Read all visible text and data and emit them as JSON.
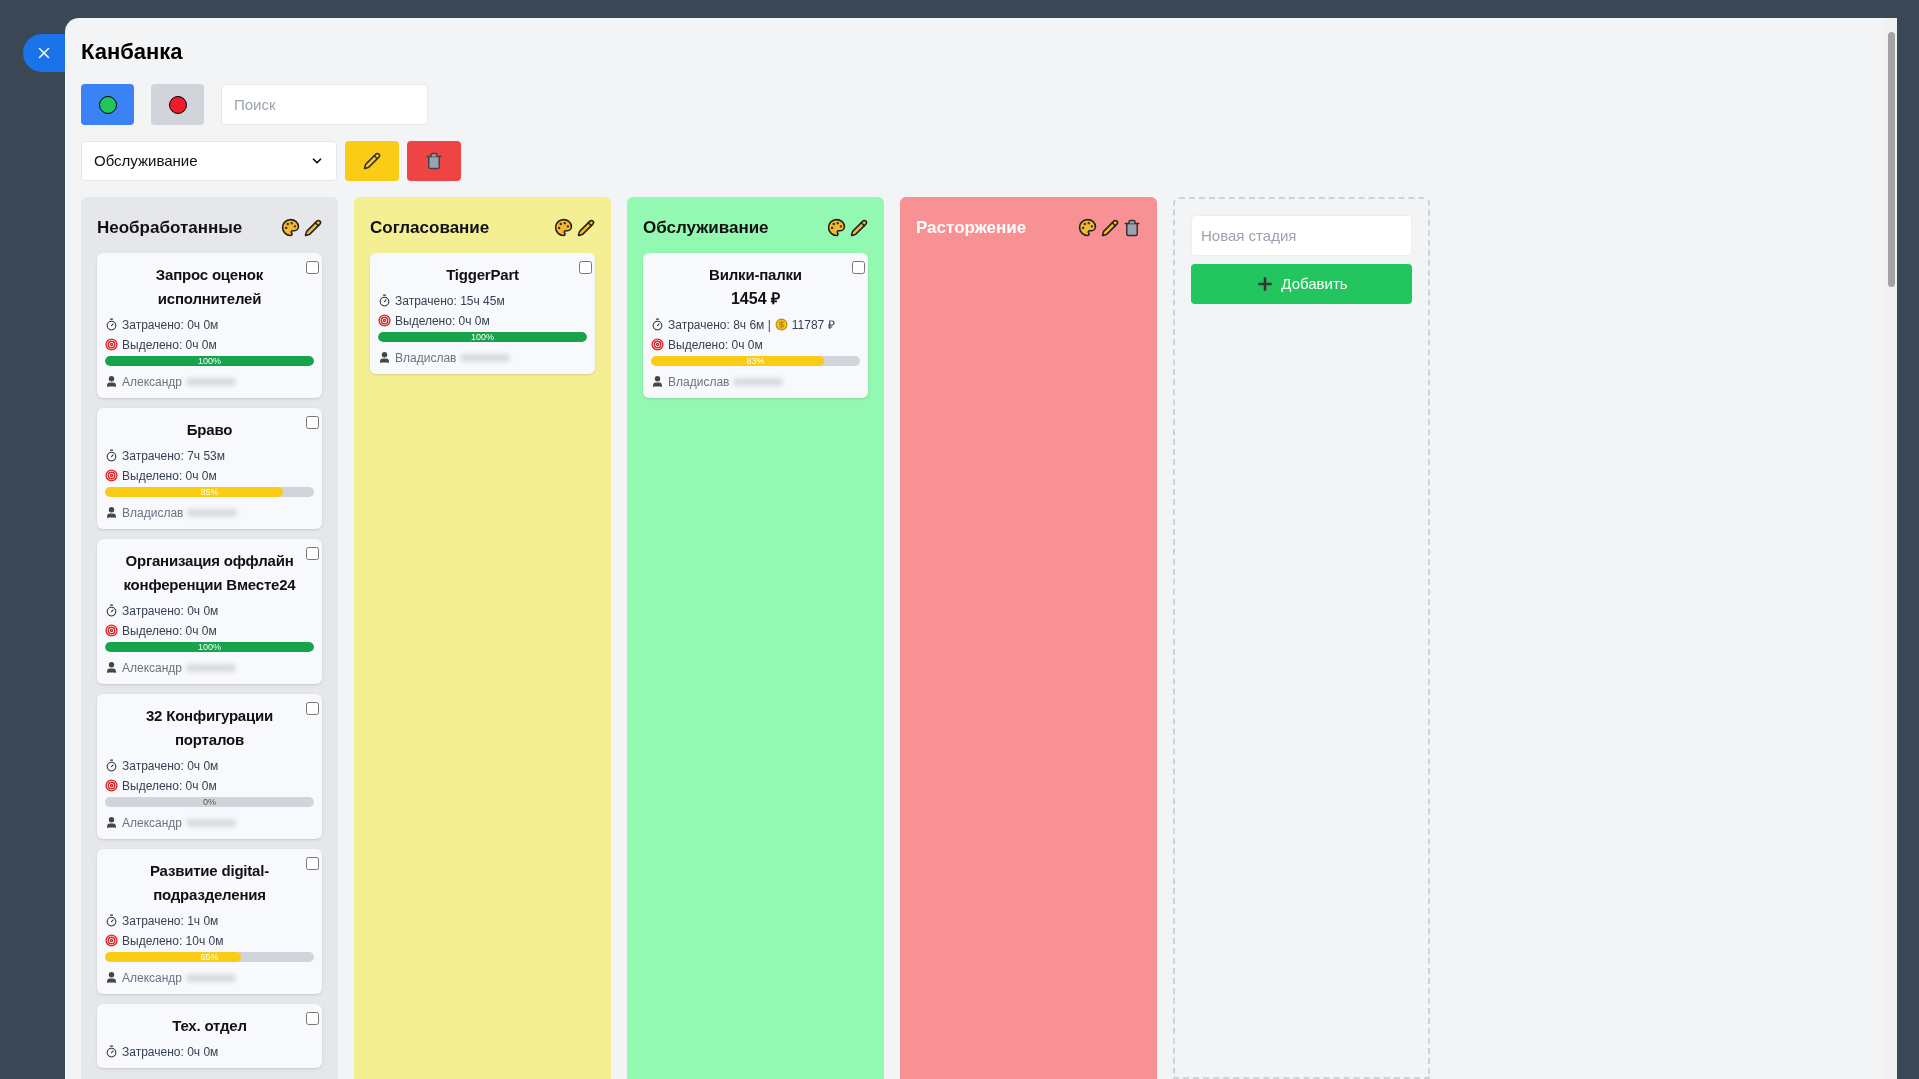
{
  "title": "Канбанка",
  "view_toggles": [
    {
      "kind": "green",
      "selected": true
    },
    {
      "kind": "red",
      "selected": false
    }
  ],
  "search": {
    "placeholder": "Поиск"
  },
  "stage_select": {
    "value": "Обслуживание"
  },
  "columns": [
    {
      "title": "Необработанные",
      "color": "#e5e7eb",
      "light_title": false,
      "deletable": false,
      "cards": [
        {
          "title": "Запрос оценок исполнителей",
          "checked": false,
          "spent": "Затрачено: 0ч 0м",
          "allocated": "Выделено: 0ч 0м",
          "level": 1,
          "progress": "100%",
          "user": "Александр"
        },
        {
          "title": "Браво",
          "checked": false,
          "spent": "Затрачено: 7ч 53м",
          "allocated": "Выделено: 0ч 0м",
          "level": 0.85,
          "progress": "85%",
          "user": "Владислав"
        },
        {
          "title": "Организация оффлайн конференции Вместе24",
          "checked": false,
          "spent": "Затрачено: 0ч 0м",
          "allocated": "Выделено: 0ч 0м",
          "level": 1,
          "progress": "100%",
          "user": "Александр"
        },
        {
          "title": "32 Конфигурации порталов",
          "checked": false,
          "spent": "Затрачено: 0ч 0м",
          "allocated": "Выделено: 0ч 0м",
          "level": 0,
          "progress": "0%",
          "user": "Александр"
        },
        {
          "title": "Развитие digital-подразделения",
          "checked": false,
          "spent": "Затрачено: 1ч 0м",
          "allocated": "Выделено: 10ч 0м",
          "level": 0.65,
          "progress": "65%",
          "user": "Александр"
        },
        {
          "title": "Тех. отдел",
          "checked": false,
          "spent": "Затрачено: 0ч 0м"
        }
      ]
    },
    {
      "title": "Согласование",
      "color": "#f5ef94",
      "light_title": false,
      "deletable": false,
      "cards": [
        {
          "title": "TiggerPart",
          "checked": false,
          "spent": "Затрачено: 15ч 45м",
          "allocated": "Выделено: 0ч 0м",
          "level": 1,
          "progress": "100%",
          "user": "Владислав"
        }
      ]
    },
    {
      "title": "Обслуживание",
      "color": "#93f8b1",
      "light_title": false,
      "deletable": false,
      "cards": [
        {
          "title": "Вилки-палки",
          "price": "1454 ₽",
          "checked": false,
          "spent": "Затрачено: 8ч 6м |",
          "money": "11787 ₽",
          "allocated": "Выделено: 0ч 0м",
          "level": 0.83,
          "progress": "83%",
          "user": "Владислав"
        }
      ]
    },
    {
      "title": "Расторжение",
      "color": "#f79194",
      "light_title": true,
      "deletable": true
    }
  ],
  "new_stage": {
    "placeholder": "Новая стадия",
    "button": "Добавить"
  }
}
